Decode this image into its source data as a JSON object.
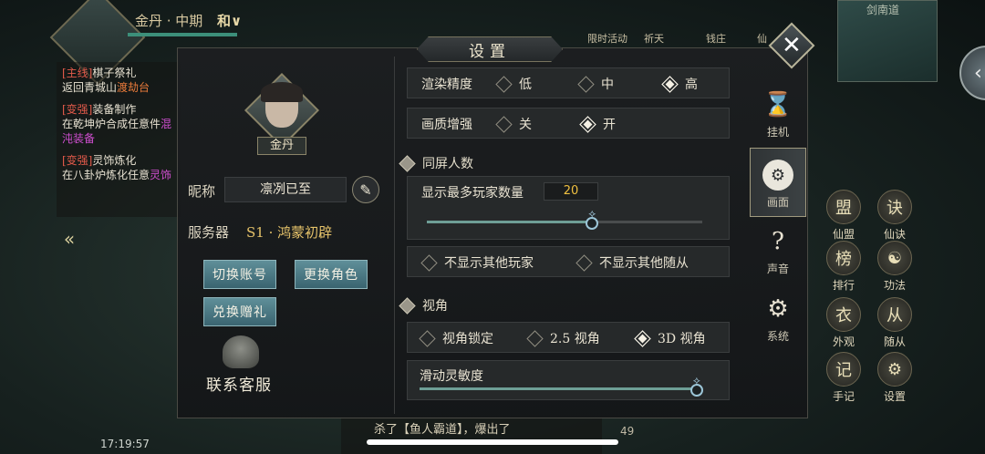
{
  "hud": {
    "player_name": "金丹 · 中期",
    "realm_badge": "和∨",
    "top_icons": [
      "限时活动",
      "祈天",
      "钱庄",
      "仙"
    ],
    "minimap_title": "剑南道",
    "clock": "17:19:57",
    "chat_text": "杀了【鱼人霸道】，爆出了",
    "chat_count": "49",
    "right_grid": [
      "仙盟",
      "仙诀",
      "排行",
      "功法",
      "外观",
      "随从",
      "手记",
      "设置"
    ],
    "quests": [
      {
        "tag": "[主线]",
        "name": "棋子祭礼",
        "desc": "返回青城山",
        "hl": "渡劫台"
      },
      {
        "tag": "[变强]",
        "name": "装备制作",
        "desc": "在乾坤炉合成任意件",
        "hl": "混沌装备"
      },
      {
        "tag": "[变强]",
        "name": "灵饰炼化",
        "desc": "在八卦炉炼化任意",
        "hl": "灵饰"
      }
    ]
  },
  "dialog": {
    "title": "设置",
    "close_glyph": "✕",
    "profile": {
      "name": "金丹",
      "nickname_label": "昵称",
      "nickname_value": "凛冽已至",
      "server_label": "服务器",
      "server_value": "S1 · 鸿蒙初辟",
      "switch_account": "切换账号",
      "change_role": "更换角色",
      "redeem_gift": "兑换赠礼",
      "contact_support": "联系客服"
    },
    "settings": {
      "render_quality_label": "渲染精度",
      "render_options": [
        "低",
        "中",
        "高"
      ],
      "render_selected": "高",
      "enhance_label": "画质增强",
      "enhance_options": [
        "关",
        "开"
      ],
      "enhance_selected": "开",
      "same_screen_section": "同屏人数",
      "max_players_label": "显示最多玩家数量",
      "max_players_value": "20",
      "max_players_slider": 0.6,
      "hide_players": "不显示其他玩家",
      "hide_followers": "不显示其他随从",
      "view_section": "视角",
      "view_options": [
        "视角锁定",
        "2.5 视角",
        "3D 视角"
      ],
      "view_selected": "3D 视角",
      "sensitivity_label": "滑动灵敏度",
      "sensitivity_slider": 0.98
    },
    "tabs": [
      {
        "label": "挂机",
        "icon": "hourglass-icon",
        "glyph": "⌛"
      },
      {
        "label": "画面",
        "icon": "display-icon",
        "glyph": "⚙",
        "active": true
      },
      {
        "label": "声音",
        "icon": "ear-icon",
        "glyph": "?"
      },
      {
        "label": "系统",
        "icon": "gear-icon",
        "glyph": "⚙"
      }
    ]
  }
}
